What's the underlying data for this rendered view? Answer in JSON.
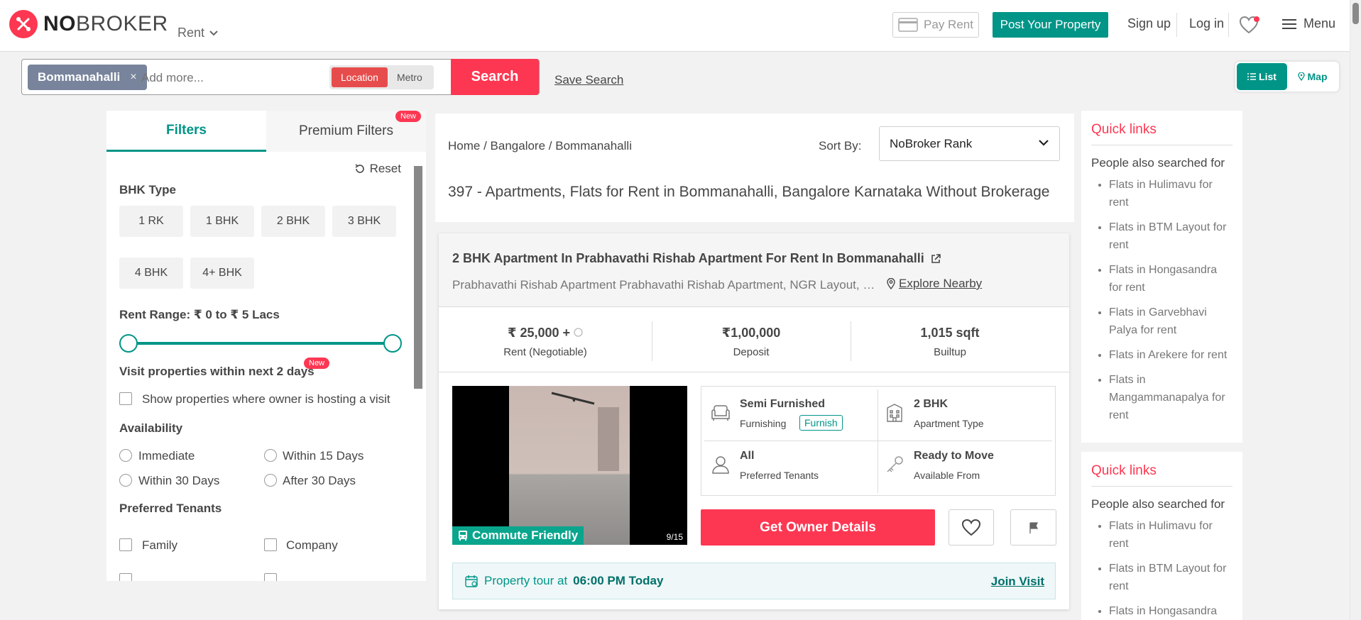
{
  "header": {
    "logo_bold": "NO",
    "logo_rest": "BROKER",
    "rent_dropdown": "Rent",
    "pay_rent": "Pay Rent",
    "post_property": "Post Your Property",
    "sign_up": "Sign up",
    "log_in": "Log in",
    "menu": "Menu"
  },
  "search": {
    "chip_label": "Bommanahalli",
    "chip_close": "×",
    "placeholder": "Add more...",
    "toggle": [
      "Location",
      "Metro"
    ],
    "search_button": "Search",
    "save_search": "Save Search",
    "view_list": "List",
    "view_map": "Map"
  },
  "filters": {
    "tab_filters": "Filters",
    "tab_premium": "Premium Filters",
    "new_badge": "New",
    "reset": "Reset",
    "bhk_heading": "BHK Type",
    "bhk_options": [
      "1 RK",
      "1 BHK",
      "2 BHK",
      "3 BHK",
      "4 BHK",
      "4+ BHK"
    ],
    "rent_range": "Rent Range: ₹ 0 to ₹ 5 Lacs",
    "visit_heading": "Visit properties within next 2 days",
    "visit_checkbox": "Show properties where owner is hosting a visit",
    "availability_heading": "Availability",
    "availability": [
      "Immediate",
      "Within 15 Days",
      "Within 30 Days",
      "After 30 Days"
    ],
    "tenants_heading": "Preferred Tenants",
    "tenants": [
      "Family",
      "Company"
    ]
  },
  "listing_header": {
    "breadcrumb": [
      "Home",
      "Bangalore",
      "Bommanahalli"
    ],
    "sort_by_label": "Sort By:",
    "sort_value": "NoBroker Rank",
    "title": "397 - Apartments, Flats for Rent in Bommanahalli, Bangalore Karnataka Without Brokerage"
  },
  "property": {
    "title": "2 BHK Apartment In Prabhavathi Rishab Apartment For Rent In Bommanahalli",
    "address": "Prabhavathi Rishab Apartment  Prabhavathi Rishab Apartment, NGR Layout, Roopena Agrahara",
    "explore": "Explore Nearby",
    "rent_value": "₹ 25,000 +",
    "rent_label": "Rent (Negotiable)",
    "deposit_value": "₹1,00,000",
    "deposit_label": "Deposit",
    "builtup_value": "1,015 sqft",
    "builtup_label": "Builtup",
    "commute": "Commute Friendly",
    "photo_count": "9/15",
    "furnishing_value": "Semi Furnished",
    "furnishing_label": "Furnishing",
    "furnish_tag": "Furnish",
    "apt_type_value": "2 BHK",
    "apt_type_label": "Apartment Type",
    "tenants_value": "All",
    "tenants_label": "Preferred Tenants",
    "available_value": "Ready to Move",
    "available_label": "Available From",
    "cta": "Get Owner Details",
    "tour_text": "Property tour at",
    "tour_time": "06:00 PM Today",
    "join_visit": "Join Visit"
  },
  "quick_links": [
    {
      "title": "Quick links",
      "subtitle": "People also searched for",
      "links": [
        "Flats in Hulimavu for rent",
        "Flats in BTM Layout for rent",
        "Flats in Hongasandra for rent",
        "Flats in Garvebhavi Palya for rent",
        "Flats in Arekere for rent",
        "Flats in Mangammanapalya for rent"
      ]
    },
    {
      "title": "Quick links",
      "subtitle": "People also searched for",
      "links": [
        "Flats in Hulimavu for rent",
        "Flats in BTM Layout for rent",
        "Flats in Hongasandra"
      ]
    }
  ],
  "colors": {
    "brand_red": "#fd3752",
    "teal": "#009587"
  }
}
